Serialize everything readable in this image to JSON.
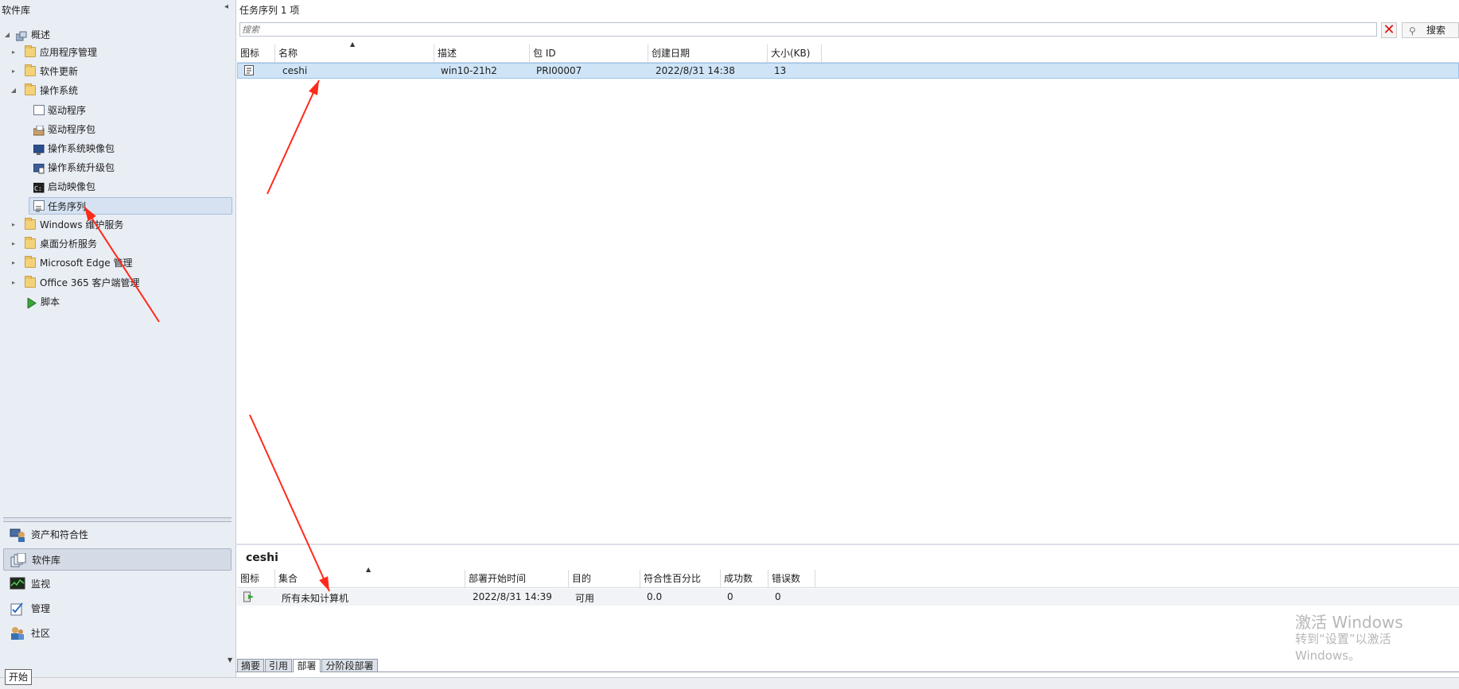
{
  "nav": {
    "title": "软件库",
    "tree": [
      {
        "label": "概述",
        "icon": "overview-icon",
        "toggle": "expanded"
      },
      {
        "label": "应用程序管理",
        "icon": "folder-icon",
        "toggle": "collapsed"
      },
      {
        "label": "软件更新",
        "icon": "folder-icon",
        "toggle": "collapsed"
      },
      {
        "label": "操作系统",
        "icon": "folder-icon",
        "toggle": "expanded"
      },
      {
        "label": "驱动程序",
        "icon": "driver-icon",
        "toggle": "none"
      },
      {
        "label": "驱动程序包",
        "icon": "driver-package-icon",
        "toggle": "none"
      },
      {
        "label": "操作系统映像包",
        "icon": "os-image-icon",
        "toggle": "none"
      },
      {
        "label": "操作系统升级包",
        "icon": "os-upgrade-icon",
        "toggle": "none"
      },
      {
        "label": "启动映像包",
        "icon": "boot-image-icon",
        "toggle": "none"
      },
      {
        "label": "任务序列",
        "icon": "task-sequence-icon",
        "toggle": "none",
        "selected": true
      },
      {
        "label": "Windows 维护服务",
        "icon": "folder-icon",
        "toggle": "collapsed"
      },
      {
        "label": "桌面分析服务",
        "icon": "folder-icon",
        "toggle": "collapsed"
      },
      {
        "label": "Microsoft Edge 管理",
        "icon": "folder-icon",
        "toggle": "collapsed"
      },
      {
        "label": "Office 365 客户端管理",
        "icon": "folder-icon",
        "toggle": "collapsed"
      },
      {
        "label": "脚本",
        "icon": "script-icon",
        "toggle": "none"
      }
    ],
    "workspaces": [
      {
        "label": "资产和符合性",
        "icon": "assets-icon"
      },
      {
        "label": "软件库",
        "icon": "software-library-icon",
        "selected": true
      },
      {
        "label": "监视",
        "icon": "monitoring-icon"
      },
      {
        "label": "管理",
        "icon": "administration-icon"
      },
      {
        "label": "社区",
        "icon": "community-icon"
      }
    ]
  },
  "main": {
    "title": "任务序列 1 项",
    "search": {
      "placeholder": "搜索",
      "button_label": "搜索"
    },
    "columns": [
      "图标",
      "名称",
      "描述",
      "包 ID",
      "创建日期",
      "大小(KB)"
    ],
    "rows": [
      {
        "name": "ceshi",
        "description": "win10-21h2",
        "package_id": "PRI00007",
        "created": "2022/8/31 14:38",
        "size": "13"
      }
    ]
  },
  "detail": {
    "title": "ceshi",
    "columns": [
      "图标",
      "集合",
      "部署开始时间",
      "目的",
      "符合性百分比",
      "成功数",
      "错误数"
    ],
    "rows": [
      {
        "collection": "所有未知计算机",
        "start_time": "2022/8/31 14:39",
        "purpose": "可用",
        "compliance": "0.0",
        "success": "0",
        "errors": "0"
      }
    ],
    "tabs": [
      "摘要",
      "引用",
      "部署",
      "分阶段部署"
    ],
    "active_tab": "部署"
  },
  "watermark": {
    "line1": "激活 Windows",
    "line2": "转到“设置”以激活 Windows。"
  },
  "tooltip": "开始",
  "annotation_color": "#ff2a1a"
}
